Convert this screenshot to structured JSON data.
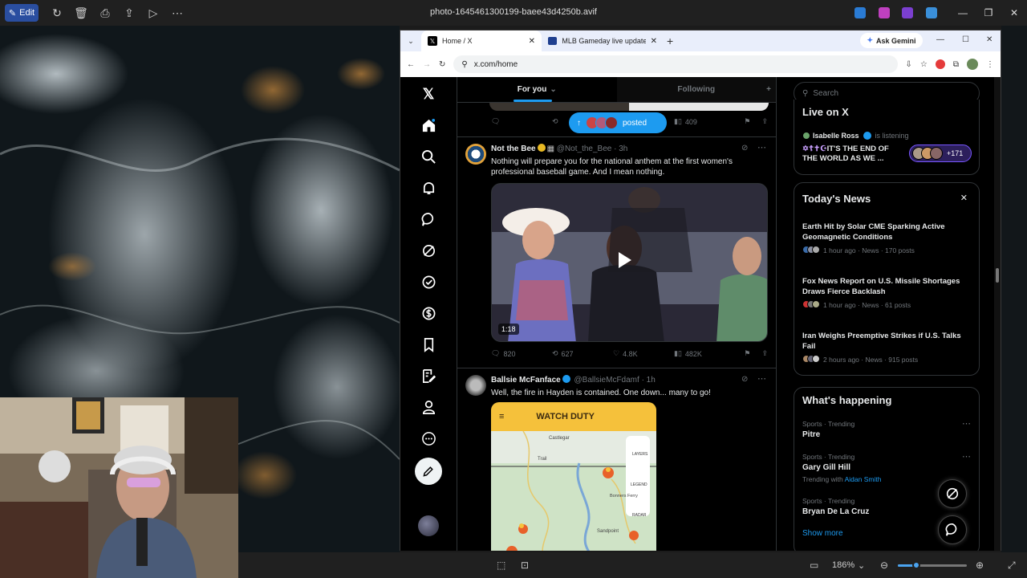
{
  "viewer": {
    "edit_label": "Edit",
    "file_name": "photo-1645461300199-baee43d4250b.avif",
    "zoom": "186%"
  },
  "browser": {
    "tabs": [
      {
        "label": "Home / X"
      },
      {
        "label": "MLB Gameday live updates: Pi"
      }
    ],
    "ask_gemini": "Ask Gemini",
    "url": "x.com/home"
  },
  "feed": {
    "tab_for_you": "For you",
    "tab_following": "Following",
    "pill_label": "posted",
    "prev_views": "409",
    "tweets": [
      {
        "name": "Not the Bee",
        "handle": "@Not_the_Bee",
        "time": "· 3h",
        "text": "Nothing will prepare you for the national anthem at the first women's professional baseball game. And I mean nothing.",
        "duration": "1:18",
        "replies": "820",
        "reposts": "627",
        "likes": "4.8K",
        "views": "482K"
      },
      {
        "name": "Ballsie McFanface",
        "handle": "@BallsieMcFdamf",
        "time": "· 1h",
        "text": "Well, the fire in Hayden is contained. One down... many to go!",
        "map_title": "WATCH DUTY",
        "map_labels": [
          "LAYERS",
          "LEGEND",
          "RADAR",
          "Castlegar",
          "Trail",
          "Bonners Ferry",
          "Sandpoint"
        ]
      }
    ]
  },
  "sidebar": {
    "search_placeholder": "Search",
    "live": {
      "title": "Live on X",
      "host": "Isabelle Ross",
      "status": "is listening",
      "space_title": "IT'S THE END OF THE WORLD AS WE ...",
      "count": "+171"
    },
    "news": {
      "title": "Today's News",
      "items": [
        {
          "title": "Earth Hit by Solar CME Sparking Active Geomagnetic Conditions",
          "meta": "1 hour ago · News · 170 posts"
        },
        {
          "title": "Fox News Report on U.S. Missile Shortages Draws Fierce Backlash",
          "meta": "1 hour ago · News · 61 posts"
        },
        {
          "title": "Iran Weighs Preemptive Strikes if U.S. Talks Fail",
          "meta": "2 hours ago · News · 915 posts"
        }
      ]
    },
    "happening": {
      "title": "What's happening",
      "items": [
        {
          "category": "Sports · Trending",
          "title": "Pitre",
          "extra_prefix": "",
          "extra_link": ""
        },
        {
          "category": "Sports · Trending",
          "title": "Gary Gill Hill",
          "extra_prefix": "Trending with",
          "extra_link": "Aidan Smith"
        },
        {
          "category": "Sports · Trending",
          "title": "Bryan De La Cruz",
          "extra_prefix": "",
          "extra_link": ""
        }
      ],
      "show_more": "Show more"
    }
  },
  "colors": {
    "accent": "#1d9bf0",
    "watch_duty": "#f5c13b",
    "verified_gold": "#e8b923"
  }
}
